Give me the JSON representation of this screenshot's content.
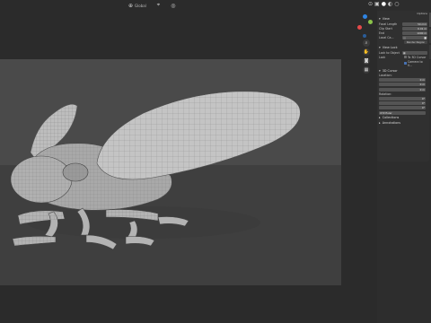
{
  "header": {
    "shading_menu": "Global",
    "icons": [
      "mouse-select-icon",
      "global-transform-icon",
      "snap-icon",
      "proportional-icon",
      "overlay-icon",
      "xray-icon",
      "shading-solid-icon",
      "shading-material-icon",
      "shading-render-icon",
      "options-icon"
    ]
  },
  "gizmo": {
    "axes": [
      {
        "label": "Z",
        "color": "#2f84e3"
      },
      {
        "label": "Y",
        "color": "#8bc34a"
      },
      {
        "label": "X",
        "color": "#e64a4a"
      }
    ],
    "nav_icons": [
      "zoom-icon",
      "pan-icon",
      "camera-view-icon",
      "grid-view-icon"
    ]
  },
  "npanel": {
    "options_label": "Options",
    "view_header": "View",
    "focal_label": "Focal Length",
    "focal_value": "50 mm",
    "clip_start_label": "Clip Start",
    "clip_start_value": "0.01 m",
    "clip_end_label": "End",
    "clip_end_value": "1000 m",
    "local_camera_label": "Local Ca...",
    "render_region_label": "Render Region",
    "view_lock_header": "View Lock",
    "lock_object_label": "Lock to Object",
    "lock_label": "Lock",
    "to_3d_cursor_label": "To 3D Cursor",
    "camera_to_view_label": "Camera to V...",
    "cursor_header": "3D Cursor",
    "location_label": "Location:",
    "loc_x": "0 m",
    "loc_y": "0 m",
    "loc_z": "0 m",
    "rotation_label": "Rotation:",
    "rot_x": "0°",
    "rot_y": "0°",
    "rot_z": "0°",
    "rotation_mode": "XYZ Euler",
    "collections_header": "Collections",
    "annotations_header": "Annotations"
  }
}
